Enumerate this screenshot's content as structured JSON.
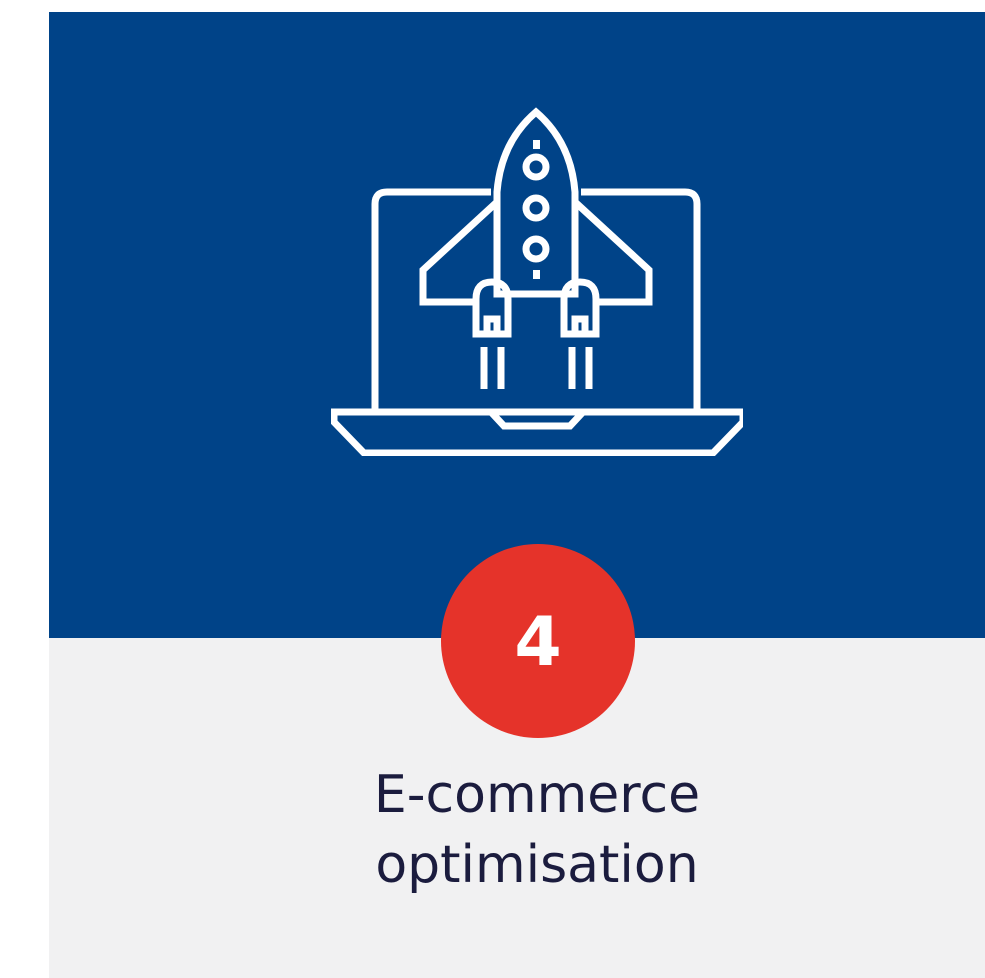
{
  "card": {
    "icon": "laptop-rocket-icon",
    "step_number": "4",
    "title_line_1": "E-commerce",
    "title_line_2": "optimisation"
  },
  "colors": {
    "top_background": "#004388",
    "bottom_background": "#f1f1f2",
    "badge": "#e5332a",
    "icon_stroke": "#ffffff",
    "title_text": "#1b1c3e"
  }
}
